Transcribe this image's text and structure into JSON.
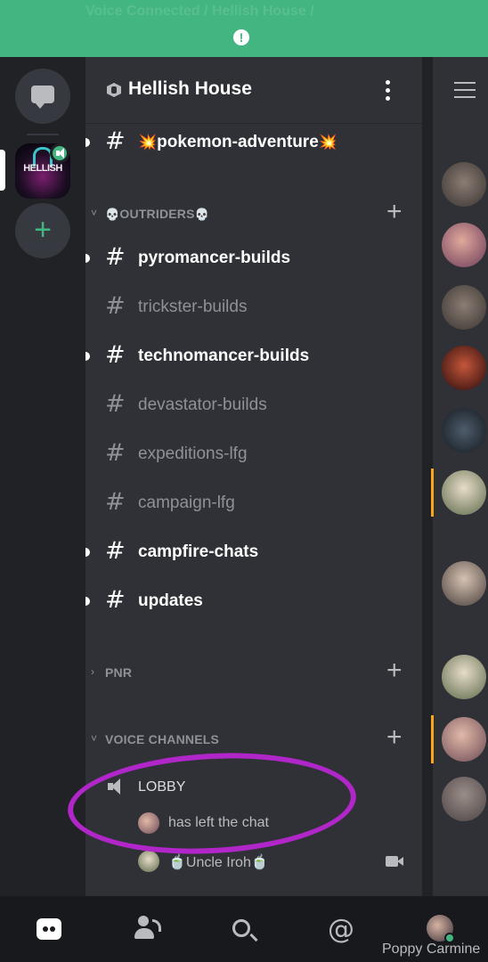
{
  "banner": {
    "text": "Voice Connected / Hellish House /",
    "icon": "alert-icon"
  },
  "server": {
    "name": "Hellish House",
    "logo_text": "HELLISH"
  },
  "channels_top": [
    {
      "name": "pokemon-adventure",
      "unread": true
    }
  ],
  "categories": {
    "outriders": {
      "name": "OUTRIDERS",
      "emoji": "💀"
    },
    "pnr": {
      "name": "PNR"
    },
    "voice": {
      "name": "VOICE CHANNELS"
    }
  },
  "outriders_channels": [
    {
      "name": "pyromancer-builds",
      "unread": true
    },
    {
      "name": "trickster-builds",
      "unread": false
    },
    {
      "name": "technomancer-builds",
      "unread": true
    },
    {
      "name": "devastator-builds",
      "unread": false
    },
    {
      "name": "expeditions-lfg",
      "unread": false
    },
    {
      "name": "campaign-lfg",
      "unread": false
    },
    {
      "name": "campfire-chats",
      "unread": true
    },
    {
      "name": "updates",
      "unread": true
    }
  ],
  "voice_channel": {
    "name": "LOBBY",
    "members": [
      {
        "name": "has left the chat"
      },
      {
        "name": "Uncle Iroh"
      }
    ]
  },
  "icons": {
    "hash": "#",
    "plus": "+",
    "chevron_down": "˅",
    "chevron_right": "›",
    "at": "@",
    "emoji_boom": "💥",
    "emoji_cup": "🍵"
  },
  "colors": {
    "brand_green": "#43b581",
    "annotation_purple": "#b026c8",
    "highlight_orange": "#faa61a",
    "panel_bg": "#2f3136"
  },
  "user": {
    "name": "Poppy Carmine"
  }
}
